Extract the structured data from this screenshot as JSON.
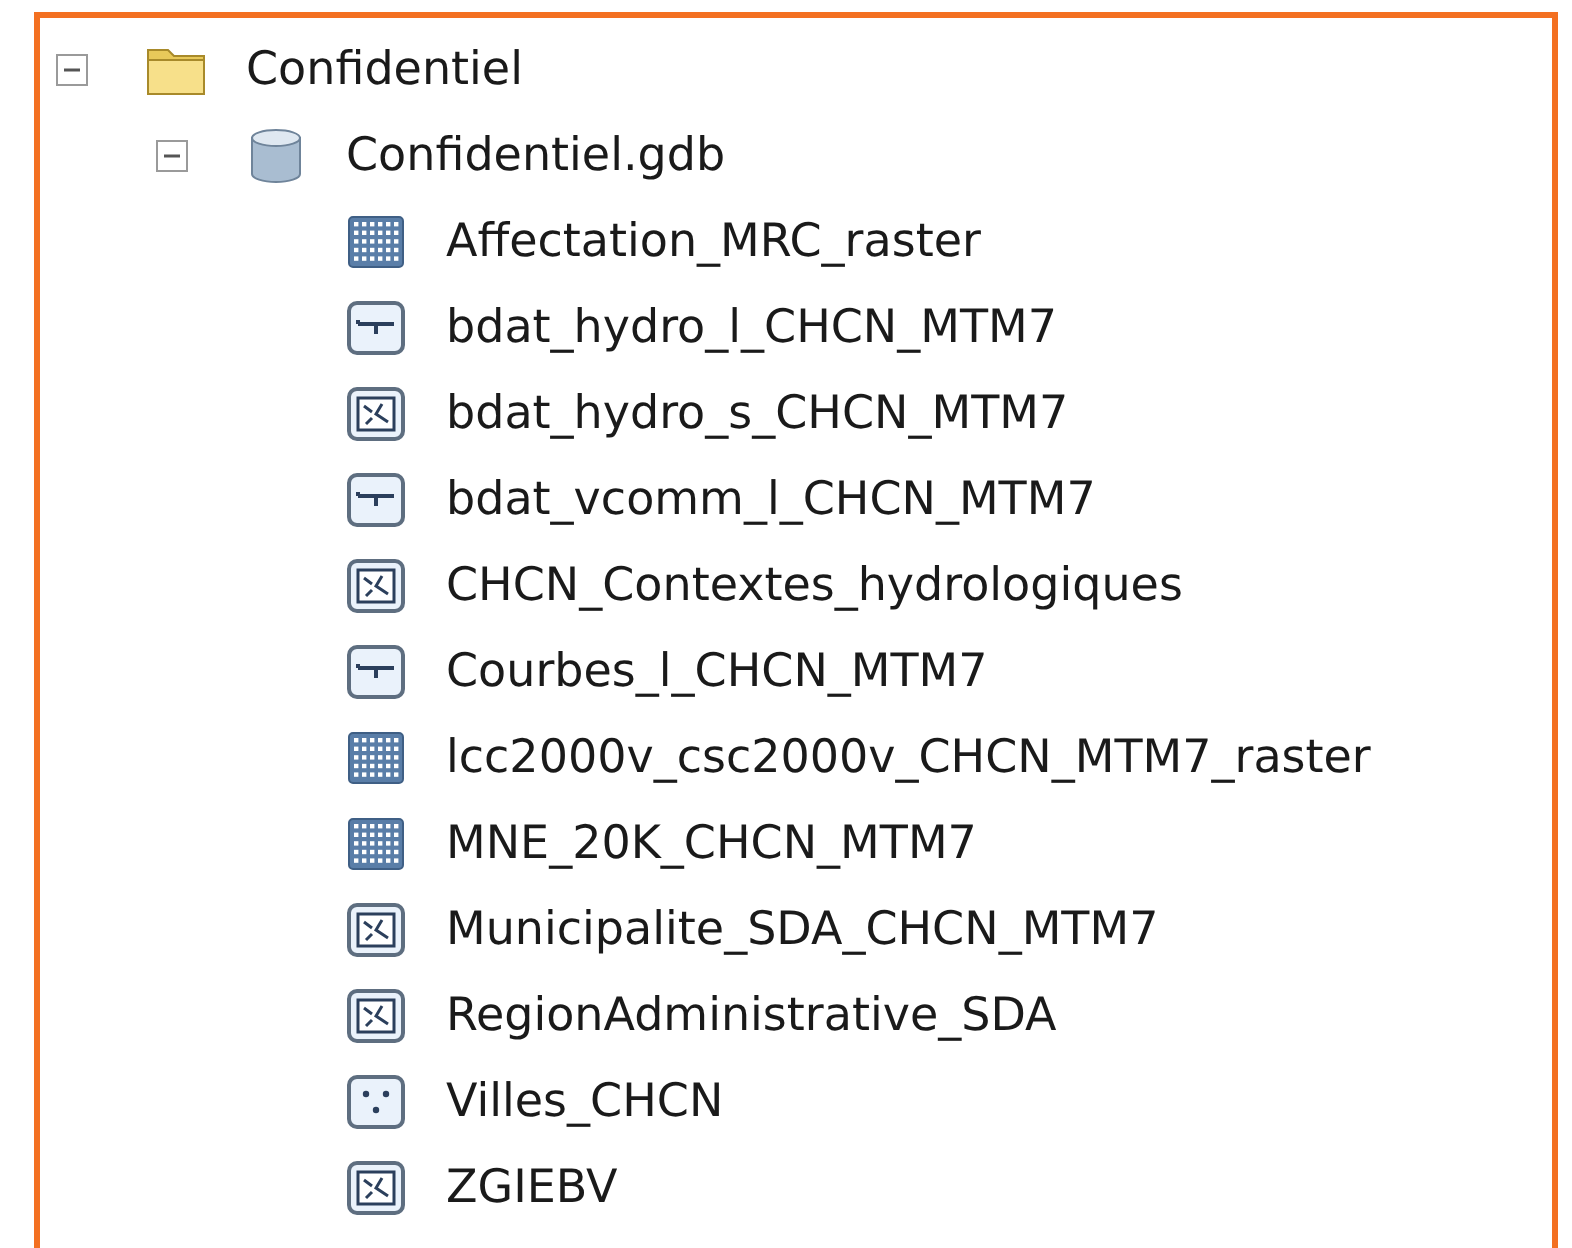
{
  "tree": [
    {
      "label": "Confidentiel",
      "kind": "folder",
      "expanded": true,
      "children": [
        {
          "label": "Confidentiel.gdb",
          "kind": "geodatabase",
          "expanded": true,
          "children": [
            {
              "label": "Affectation_MRC_raster",
              "kind": "raster"
            },
            {
              "label": "bdat_hydro_l_CHCN_MTM7",
              "kind": "line"
            },
            {
              "label": "bdat_hydro_s_CHCN_MTM7",
              "kind": "polygon"
            },
            {
              "label": "bdat_vcomm_l_CHCN_MTM7",
              "kind": "line"
            },
            {
              "label": "CHCN_Contextes_hydrologiques",
              "kind": "polygon"
            },
            {
              "label": "Courbes_l_CHCN_MTM7",
              "kind": "line"
            },
            {
              "label": "lcc2000v_csc2000v_CHCN_MTM7_raster",
              "kind": "raster"
            },
            {
              "label": "MNE_20K_CHCN_MTM7",
              "kind": "raster"
            },
            {
              "label": "Municipalite_SDA_CHCN_MTM7",
              "kind": "polygon"
            },
            {
              "label": "RegionAdministrative_SDA",
              "kind": "polygon"
            },
            {
              "label": "Villes_CHCN",
              "kind": "point"
            },
            {
              "label": "ZGIEBV",
              "kind": "polygon"
            }
          ]
        }
      ]
    }
  ]
}
